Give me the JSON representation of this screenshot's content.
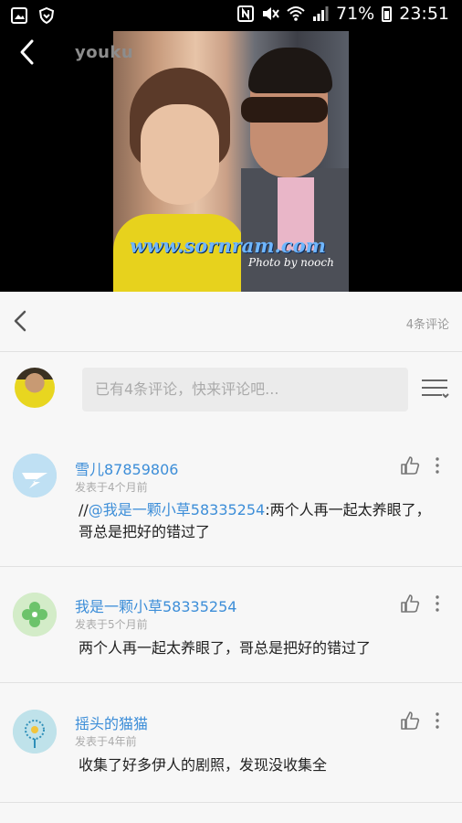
{
  "status_bar": {
    "battery": "71%",
    "time": "23:51"
  },
  "video": {
    "logo": "youku",
    "watermark_url": "www.sornram.com",
    "watermark_credit": "Photo by nooch"
  },
  "comments_bar": {
    "count_label": "4条评论"
  },
  "composer": {
    "placeholder": "已有4条评论，快来评论吧..."
  },
  "comments": [
    {
      "user": "雪儿87859806",
      "time": "发表于4个月前",
      "prefix": "//",
      "mention": "@我是一颗小草58335254",
      "text": ":两个人再一起太养眼了，哥总是把好的错过了"
    },
    {
      "user": "我是一颗小草58335254",
      "time": "发表于5个月前",
      "text": "两个人再一起太养眼了，哥总是把好的错过了"
    },
    {
      "user": "摇头的猫猫",
      "time": "发表于4年前",
      "text": "收集了好多伊人的剧照，发现没收集全"
    }
  ],
  "colors": {
    "accent": "#3d8ed8",
    "background": "#f7f7f7"
  }
}
